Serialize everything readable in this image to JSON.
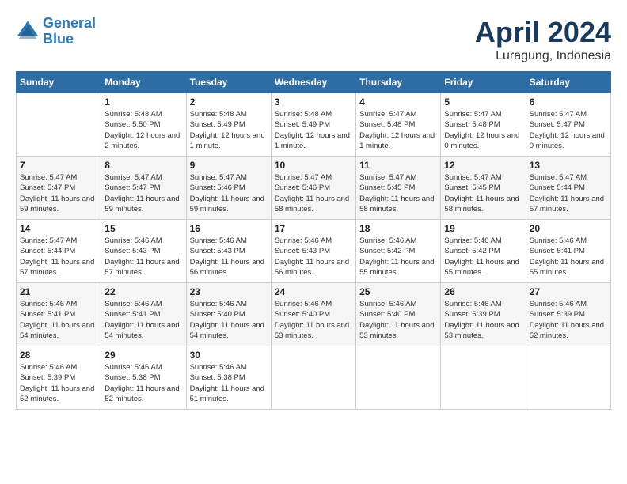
{
  "header": {
    "logo_line1": "General",
    "logo_line2": "Blue",
    "month_title": "April 2024",
    "location": "Luragung, Indonesia"
  },
  "weekdays": [
    "Sunday",
    "Monday",
    "Tuesday",
    "Wednesday",
    "Thursday",
    "Friday",
    "Saturday"
  ],
  "weeks": [
    [
      {
        "day": "",
        "sunrise": "",
        "sunset": "",
        "daylight": ""
      },
      {
        "day": "1",
        "sunrise": "Sunrise: 5:48 AM",
        "sunset": "Sunset: 5:50 PM",
        "daylight": "Daylight: 12 hours and 2 minutes."
      },
      {
        "day": "2",
        "sunrise": "Sunrise: 5:48 AM",
        "sunset": "Sunset: 5:49 PM",
        "daylight": "Daylight: 12 hours and 1 minute."
      },
      {
        "day": "3",
        "sunrise": "Sunrise: 5:48 AM",
        "sunset": "Sunset: 5:49 PM",
        "daylight": "Daylight: 12 hours and 1 minute."
      },
      {
        "day": "4",
        "sunrise": "Sunrise: 5:47 AM",
        "sunset": "Sunset: 5:48 PM",
        "daylight": "Daylight: 12 hours and 1 minute."
      },
      {
        "day": "5",
        "sunrise": "Sunrise: 5:47 AM",
        "sunset": "Sunset: 5:48 PM",
        "daylight": "Daylight: 12 hours and 0 minutes."
      },
      {
        "day": "6",
        "sunrise": "Sunrise: 5:47 AM",
        "sunset": "Sunset: 5:47 PM",
        "daylight": "Daylight: 12 hours and 0 minutes."
      }
    ],
    [
      {
        "day": "7",
        "sunrise": "Sunrise: 5:47 AM",
        "sunset": "Sunset: 5:47 PM",
        "daylight": "Daylight: 11 hours and 59 minutes."
      },
      {
        "day": "8",
        "sunrise": "Sunrise: 5:47 AM",
        "sunset": "Sunset: 5:47 PM",
        "daylight": "Daylight: 11 hours and 59 minutes."
      },
      {
        "day": "9",
        "sunrise": "Sunrise: 5:47 AM",
        "sunset": "Sunset: 5:46 PM",
        "daylight": "Daylight: 11 hours and 59 minutes."
      },
      {
        "day": "10",
        "sunrise": "Sunrise: 5:47 AM",
        "sunset": "Sunset: 5:46 PM",
        "daylight": "Daylight: 11 hours and 58 minutes."
      },
      {
        "day": "11",
        "sunrise": "Sunrise: 5:47 AM",
        "sunset": "Sunset: 5:45 PM",
        "daylight": "Daylight: 11 hours and 58 minutes."
      },
      {
        "day": "12",
        "sunrise": "Sunrise: 5:47 AM",
        "sunset": "Sunset: 5:45 PM",
        "daylight": "Daylight: 11 hours and 58 minutes."
      },
      {
        "day": "13",
        "sunrise": "Sunrise: 5:47 AM",
        "sunset": "Sunset: 5:44 PM",
        "daylight": "Daylight: 11 hours and 57 minutes."
      }
    ],
    [
      {
        "day": "14",
        "sunrise": "Sunrise: 5:47 AM",
        "sunset": "Sunset: 5:44 PM",
        "daylight": "Daylight: 11 hours and 57 minutes."
      },
      {
        "day": "15",
        "sunrise": "Sunrise: 5:46 AM",
        "sunset": "Sunset: 5:43 PM",
        "daylight": "Daylight: 11 hours and 57 minutes."
      },
      {
        "day": "16",
        "sunrise": "Sunrise: 5:46 AM",
        "sunset": "Sunset: 5:43 PM",
        "daylight": "Daylight: 11 hours and 56 minutes."
      },
      {
        "day": "17",
        "sunrise": "Sunrise: 5:46 AM",
        "sunset": "Sunset: 5:43 PM",
        "daylight": "Daylight: 11 hours and 56 minutes."
      },
      {
        "day": "18",
        "sunrise": "Sunrise: 5:46 AM",
        "sunset": "Sunset: 5:42 PM",
        "daylight": "Daylight: 11 hours and 55 minutes."
      },
      {
        "day": "19",
        "sunrise": "Sunrise: 5:46 AM",
        "sunset": "Sunset: 5:42 PM",
        "daylight": "Daylight: 11 hours and 55 minutes."
      },
      {
        "day": "20",
        "sunrise": "Sunrise: 5:46 AM",
        "sunset": "Sunset: 5:41 PM",
        "daylight": "Daylight: 11 hours and 55 minutes."
      }
    ],
    [
      {
        "day": "21",
        "sunrise": "Sunrise: 5:46 AM",
        "sunset": "Sunset: 5:41 PM",
        "daylight": "Daylight: 11 hours and 54 minutes."
      },
      {
        "day": "22",
        "sunrise": "Sunrise: 5:46 AM",
        "sunset": "Sunset: 5:41 PM",
        "daylight": "Daylight: 11 hours and 54 minutes."
      },
      {
        "day": "23",
        "sunrise": "Sunrise: 5:46 AM",
        "sunset": "Sunset: 5:40 PM",
        "daylight": "Daylight: 11 hours and 54 minutes."
      },
      {
        "day": "24",
        "sunrise": "Sunrise: 5:46 AM",
        "sunset": "Sunset: 5:40 PM",
        "daylight": "Daylight: 11 hours and 53 minutes."
      },
      {
        "day": "25",
        "sunrise": "Sunrise: 5:46 AM",
        "sunset": "Sunset: 5:40 PM",
        "daylight": "Daylight: 11 hours and 53 minutes."
      },
      {
        "day": "26",
        "sunrise": "Sunrise: 5:46 AM",
        "sunset": "Sunset: 5:39 PM",
        "daylight": "Daylight: 11 hours and 53 minutes."
      },
      {
        "day": "27",
        "sunrise": "Sunrise: 5:46 AM",
        "sunset": "Sunset: 5:39 PM",
        "daylight": "Daylight: 11 hours and 52 minutes."
      }
    ],
    [
      {
        "day": "28",
        "sunrise": "Sunrise: 5:46 AM",
        "sunset": "Sunset: 5:39 PM",
        "daylight": "Daylight: 11 hours and 52 minutes."
      },
      {
        "day": "29",
        "sunrise": "Sunrise: 5:46 AM",
        "sunset": "Sunset: 5:38 PM",
        "daylight": "Daylight: 11 hours and 52 minutes."
      },
      {
        "day": "30",
        "sunrise": "Sunrise: 5:46 AM",
        "sunset": "Sunset: 5:38 PM",
        "daylight": "Daylight: 11 hours and 51 minutes."
      },
      {
        "day": "",
        "sunrise": "",
        "sunset": "",
        "daylight": ""
      },
      {
        "day": "",
        "sunrise": "",
        "sunset": "",
        "daylight": ""
      },
      {
        "day": "",
        "sunrise": "",
        "sunset": "",
        "daylight": ""
      },
      {
        "day": "",
        "sunrise": "",
        "sunset": "",
        "daylight": ""
      }
    ]
  ]
}
